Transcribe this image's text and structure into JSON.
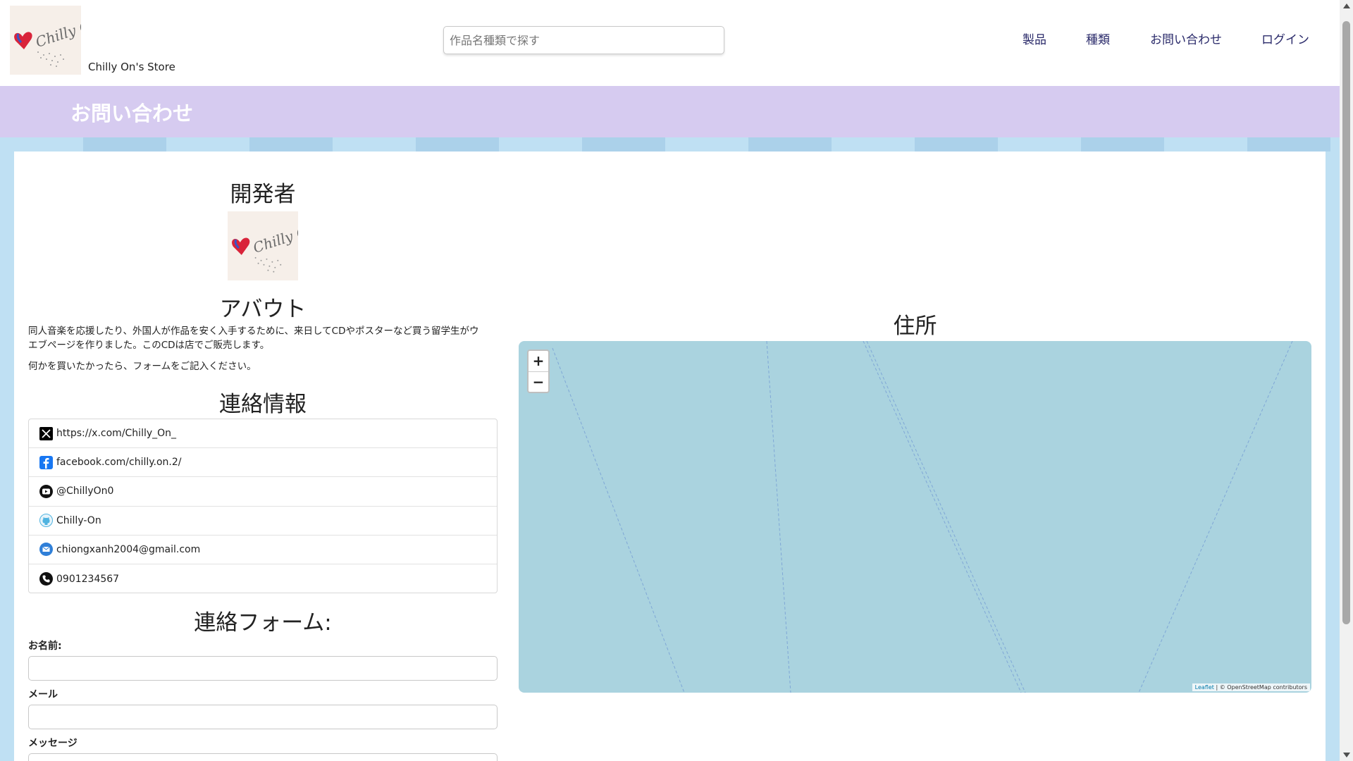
{
  "header": {
    "logo_text": "Chilly On",
    "store_name": "Chilly On's Store",
    "search_placeholder": "作品名種類で探す",
    "nav": [
      "製品",
      "種類",
      "お問い合わせ",
      "ログイン"
    ]
  },
  "banner": {
    "title": "お問い合わせ"
  },
  "developer": {
    "title": "開発者",
    "logo_text": "Chilly On"
  },
  "about": {
    "title": "アバウト",
    "paragraph1_line1": "同人音楽を応援したり、外国人が作品を安く入手するために、来日してCDやポスターなど買う留学生がウ",
    "paragraph1_line2": "エブページを作りました。このCDは店でご販売します。",
    "paragraph2": "何かを買いたかったら、フォームをご記入ください。"
  },
  "contact_info": {
    "title": "連絡情報",
    "items": [
      {
        "icon": "x-icon",
        "text": "https://x.com/Chilly_On_"
      },
      {
        "icon": "facebook-icon",
        "text": "facebook.com/chilly.on.2/"
      },
      {
        "icon": "youtube-icon",
        "text": "@ChillyOn0"
      },
      {
        "icon": "github-icon",
        "text": "Chilly-On"
      },
      {
        "icon": "email-icon",
        "text": "chiongxanh2004@gmail.com"
      },
      {
        "icon": "phone-icon",
        "text": "0901234567"
      }
    ]
  },
  "contact_form": {
    "title": "連絡フォーム:",
    "name_label": "お名前:",
    "email_label": "メール",
    "message_label": "メッセージ"
  },
  "address": {
    "title": "住所",
    "zoom_in": "+",
    "zoom_out": "−",
    "attribution_leaflet": "Leaflet",
    "attribution_rest": " | © OpenStreetMap contributors"
  },
  "colors": {
    "banner": "#d6cbf0",
    "page_background": "#bfe0f3",
    "map_water": "#aad3df",
    "nav_text": "#2a2a6a"
  }
}
